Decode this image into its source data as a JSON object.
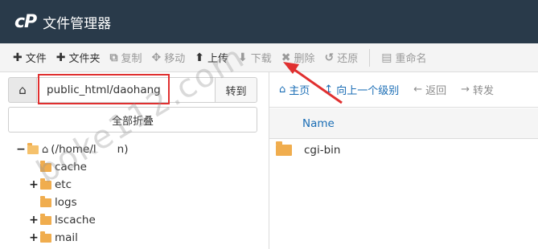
{
  "header": {
    "logo": "cP",
    "title": "文件管理器"
  },
  "toolbar": {
    "items": [
      {
        "icon": "plus-icon",
        "glyph": "✚",
        "label": "文件",
        "enabled": true
      },
      {
        "icon": "plus-icon",
        "glyph": "✚",
        "label": "文件夹",
        "enabled": true
      },
      {
        "icon": "copy-icon",
        "glyph": "⧉",
        "label": "复制",
        "enabled": false
      },
      {
        "icon": "move-icon",
        "glyph": "✥",
        "label": "移动",
        "enabled": false
      },
      {
        "icon": "upload-icon",
        "glyph": "⬆",
        "label": "上传",
        "enabled": true
      },
      {
        "icon": "download-icon",
        "glyph": "⬇",
        "label": "下载",
        "enabled": false
      },
      {
        "icon": "delete-icon",
        "glyph": "✖",
        "label": "删除",
        "enabled": false
      },
      {
        "icon": "restore-icon",
        "glyph": "↺",
        "label": "还原",
        "enabled": false
      },
      {
        "icon": "rename-icon",
        "glyph": "▤",
        "label": "重命名",
        "enabled": false
      }
    ]
  },
  "left": {
    "path_value": "public_html/daohang",
    "go_label": "转到",
    "collapse_label": "全部折叠",
    "tree": {
      "root_label": "(/home/l",
      "root_suffix": "n)",
      "items": [
        {
          "label": "cache",
          "toggle": ""
        },
        {
          "label": "etc",
          "toggle": "+"
        },
        {
          "label": "logs",
          "toggle": ""
        },
        {
          "label": "lscache",
          "toggle": "+"
        },
        {
          "label": "mail",
          "toggle": "+"
        }
      ]
    }
  },
  "right": {
    "buttons": [
      {
        "icon": "home-icon",
        "glyph": "⌂",
        "label": "主页",
        "style": "primary"
      },
      {
        "icon": "up-level-icon",
        "glyph": "↥",
        "label": "向上一个级别",
        "style": "primary"
      },
      {
        "icon": "back-icon",
        "glyph": "←",
        "label": "返回",
        "style": "disabled"
      },
      {
        "icon": "forward-icon",
        "glyph": "→",
        "label": "转发",
        "style": "disabled"
      }
    ],
    "column_name": "Name",
    "files": [
      {
        "name": "cgi-bin"
      }
    ]
  },
  "watermark": "boke112.com",
  "colors": {
    "header_bg": "#293a4a",
    "accent": "#1a6db5",
    "folder": "#f0ad4e",
    "annotation": "#e03030"
  }
}
